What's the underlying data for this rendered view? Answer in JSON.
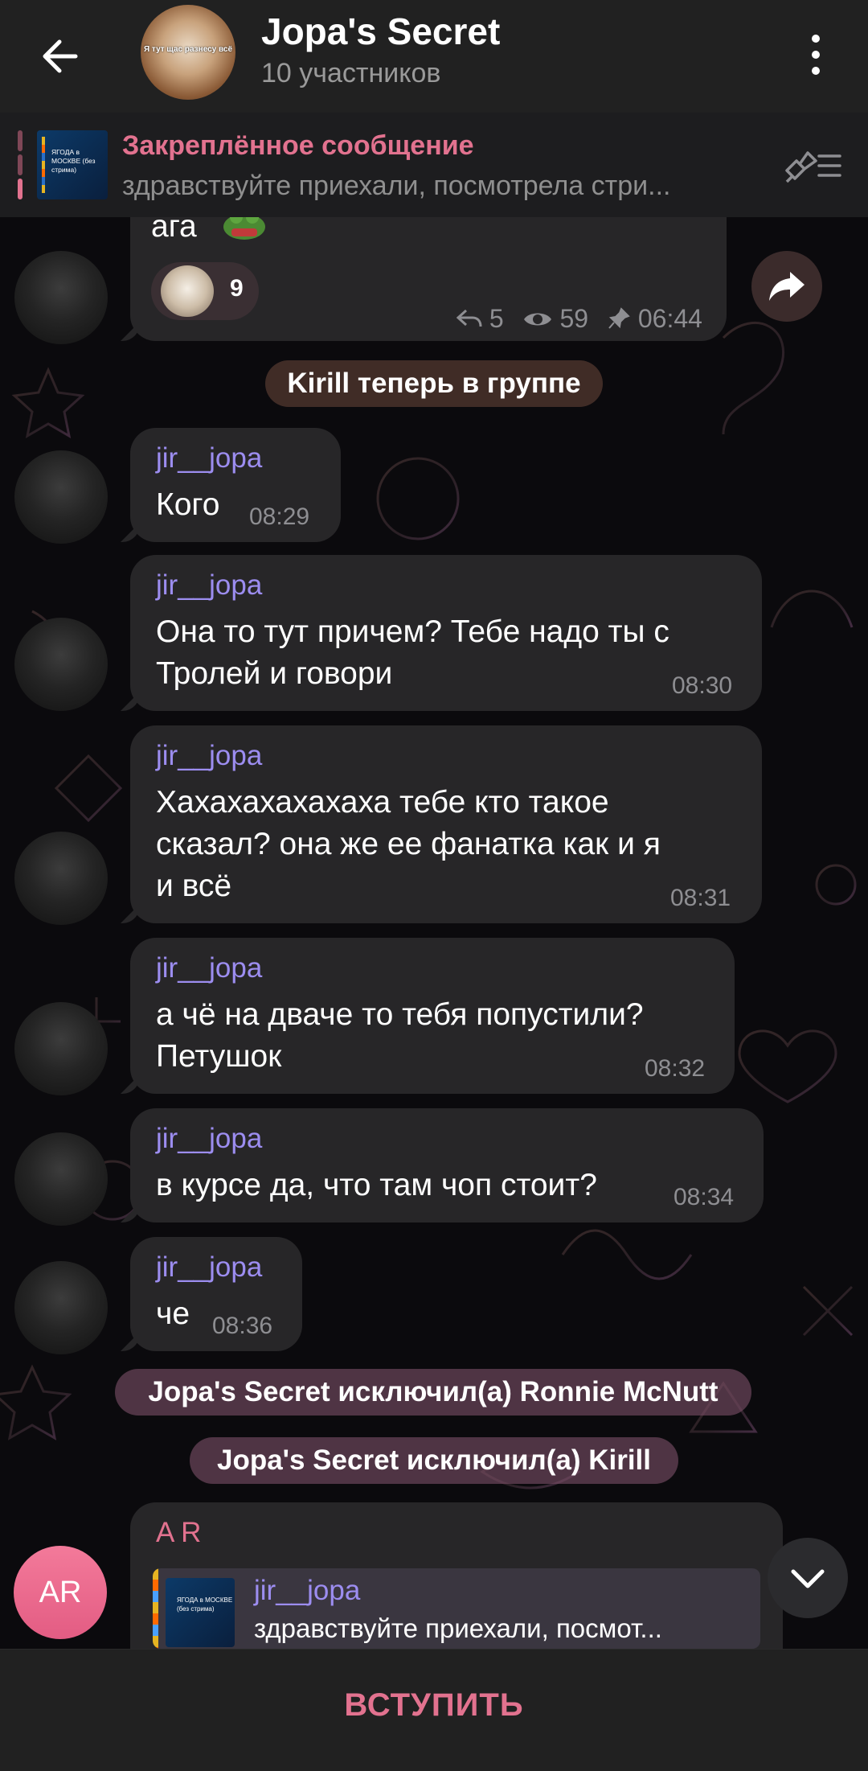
{
  "header": {
    "title": "Jopa's Secret",
    "subtitle": "10 участников",
    "avatar_caption": "Я тут щас разнесу всё"
  },
  "pinned": {
    "title": "Закреплённое сообщение",
    "text": "здравствуйте приехали, посмотрела стри...",
    "thumb_text": "ЯГОДА в МОСКВЕ (без стрима)"
  },
  "top_message": {
    "text": "ага",
    "reaction_count": "9",
    "replies": "5",
    "views": "59",
    "time": "06:44"
  },
  "services": [
    "Kirill теперь в группе",
    "Jopa's Secret исключил(а) Ronnie McNutt",
    "Jopa's Secret исключил(а) Kirill"
  ],
  "messages": [
    {
      "sender": "jir__jopa",
      "lines": [
        "Кого"
      ],
      "time": "08:29"
    },
    {
      "sender": "jir__jopa",
      "lines": [
        "Она то тут причем? Тебе надо ты с",
        "Тролей и говори"
      ],
      "time": "08:30"
    },
    {
      "sender": "jir__jopa",
      "lines": [
        "Хахахахахахаха тебе кто такое",
        "сказал? она же ее фанатка как и я",
        "и всё"
      ],
      "time": "08:31"
    },
    {
      "sender": "jir__jopa",
      "lines": [
        "а чё на дваче то тебя попустили?",
        "Петушок"
      ],
      "time": "08:32"
    },
    {
      "sender": "jir__jopa",
      "lines": [
        "в курсе да, что там чоп стоит?"
      ],
      "time": "08:34"
    },
    {
      "sender": "jir__jopa",
      "lines": [
        "че"
      ],
      "time": "08:36"
    }
  ],
  "last_message": {
    "sender": "A R",
    "avatar_initials": "AR",
    "reply_name": "jir__jopa",
    "reply_text": "здравствуйте приехали, посмот...",
    "reply_thumb_text": "ЯГОДА в МОСКВЕ (без стрима)"
  },
  "join_label": "ВСТУПИТЬ",
  "colors": {
    "accent": "#e2728f",
    "sender": "#9c8df0",
    "bubble": "#272628",
    "header": "#212121"
  }
}
